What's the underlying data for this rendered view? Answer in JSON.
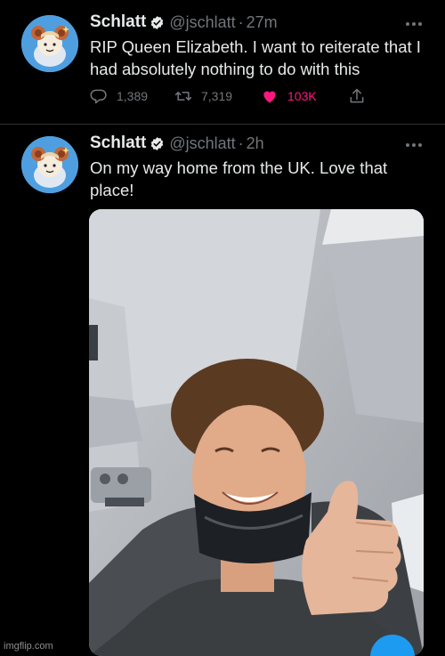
{
  "tweets": [
    {
      "name": "Schlatt",
      "handle": "@jschlatt",
      "separator": "·",
      "time": "27m",
      "text": "RIP Queen Elizabeth. I want to reiterate that I had absolutely nothing to do with this",
      "stats": {
        "replies": "1,389",
        "retweets": "7,319",
        "likes": "103K"
      }
    },
    {
      "name": "Schlatt",
      "handle": "@jschlatt",
      "separator": "·",
      "time": "2h",
      "text": "On my way home from the UK. Love that place!"
    }
  ],
  "watermark": "imgflip.com",
  "icons": {
    "verified": "verified-badge-icon",
    "more": "more-options-icon",
    "reply": "reply-icon",
    "retweet": "retweet-icon",
    "like": "heart-icon",
    "share": "share-icon"
  },
  "colors": {
    "background": "#000000",
    "text": "#e7e9ea",
    "muted": "#71767b",
    "like": "#f91880",
    "accent": "#1d9bf0"
  }
}
